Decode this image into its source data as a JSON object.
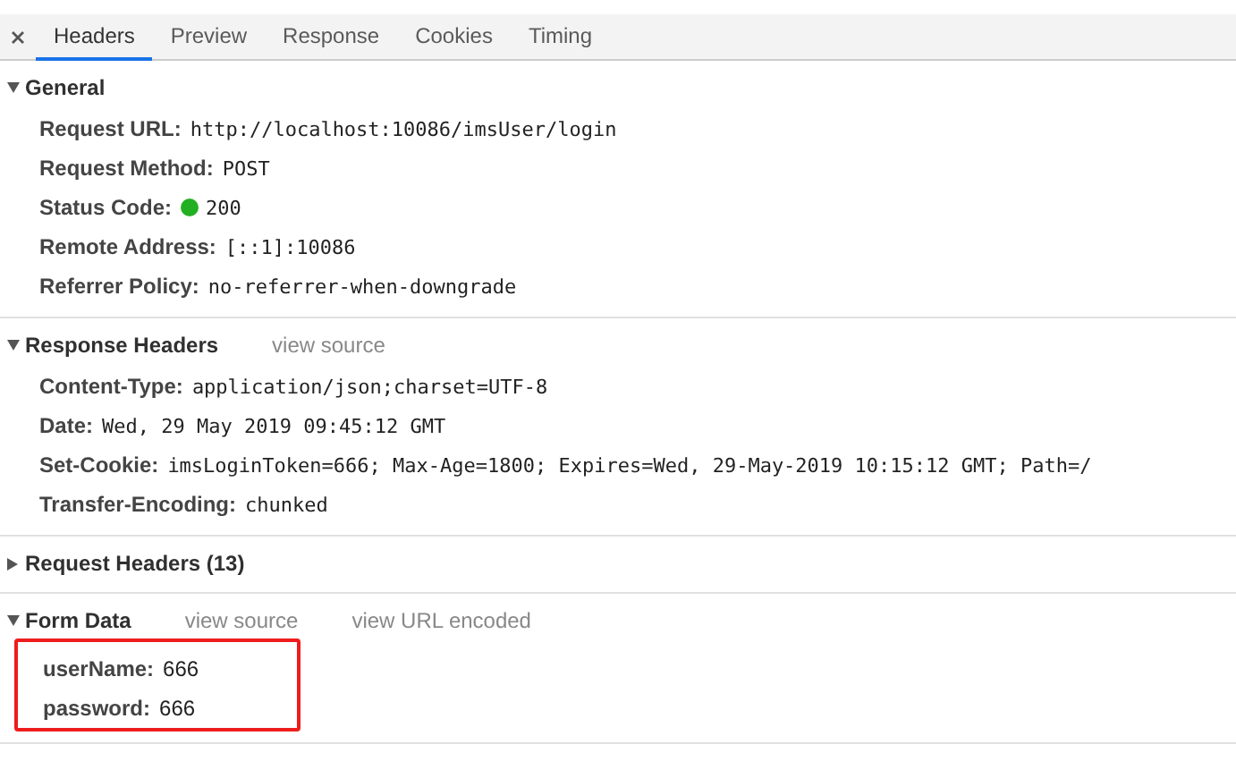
{
  "tabs": [
    {
      "label": "Headers",
      "selected": true
    },
    {
      "label": "Preview",
      "selected": false
    },
    {
      "label": "Response",
      "selected": false
    },
    {
      "label": "Cookies",
      "selected": false
    },
    {
      "label": "Timing",
      "selected": false
    }
  ],
  "sections": [
    {
      "title": "General",
      "kind": "header",
      "expanded": true,
      "rows": [
        {
          "name": "Request URL:",
          "value": "http://localhost:10086/imsUser/login"
        },
        {
          "name": "Request Method:",
          "value": "POST"
        },
        {
          "name": "Status Code:",
          "value": "200",
          "color": "#22b022"
        },
        {
          "name": "Remote Address:",
          "value": "[::1]:10086"
        },
        {
          "name": "Referrer Policy:",
          "value": "no-referrer-when-downgrade"
        }
      ]
    },
    {
      "title": "Response Headers",
      "kind": "header",
      "expanded": true,
      "links": [
        "view source"
      ],
      "rows": [
        {
          "name": "Content-Type:",
          "value": "application/json;charset=UTF-8"
        },
        {
          "name": "Date:",
          "value": "Wed, 29 May 2019 09:45:12 GMT"
        },
        {
          "name": "Set-Cookie:",
          "value": "imsLoginToken=666; Max-Age=1800; Expires=Wed, 29-May-2019 10:15:12 GMT; Path=/"
        },
        {
          "name": "Transfer-Encoding:",
          "value": "chunked"
        }
      ]
    },
    {
      "title": "Request Headers (13)",
      "expanded": false
    },
    {
      "title": "Form Data",
      "kind": "form",
      "expanded": true,
      "highlighted": true,
      "links": [
        "view source",
        "view URL encoded"
      ],
      "rows": [
        {
          "name": "userName:",
          "value": "666"
        },
        {
          "name": "password:",
          "value": "666"
        }
      ]
    }
  ]
}
